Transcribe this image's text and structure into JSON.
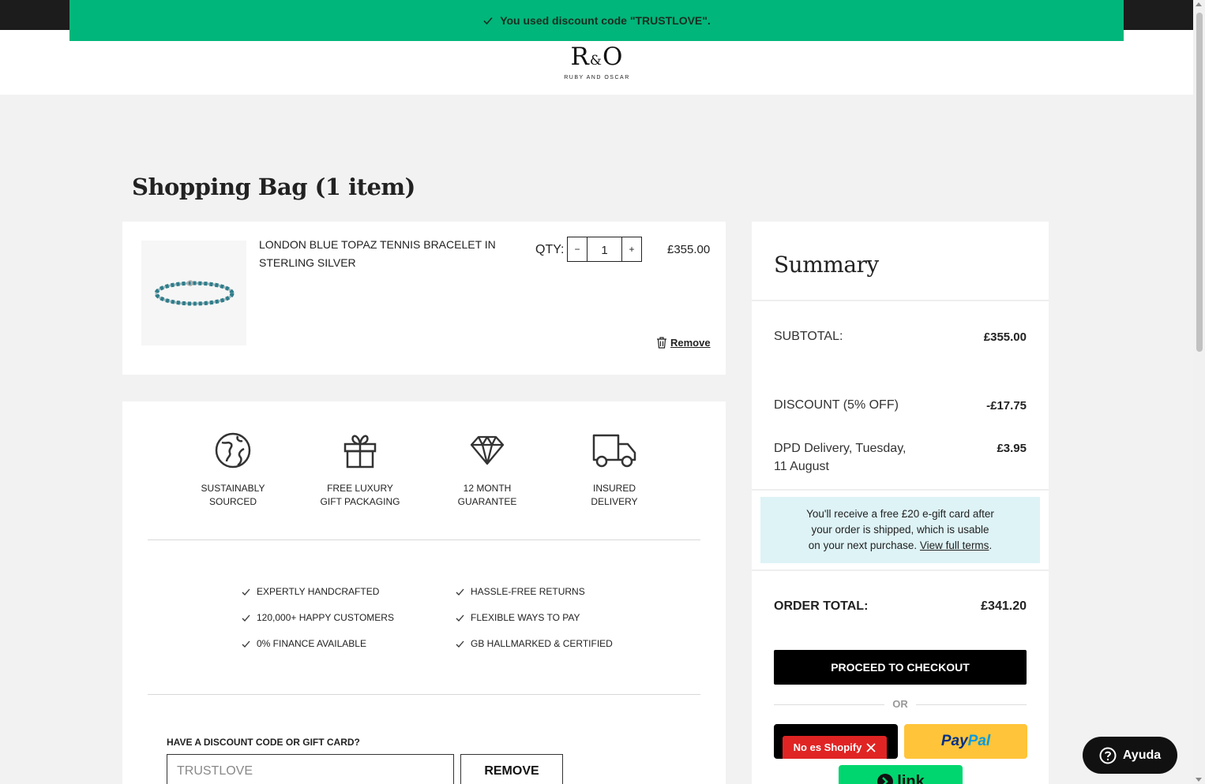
{
  "notice": {
    "text": "You used discount code \"TRUSTLOVE\"."
  },
  "logo": {
    "main_left": "R",
    "amp": "&",
    "main_right": "O",
    "sub": "RUBY AND OSCAR"
  },
  "bag": {
    "title": "Shopping Bag (1 item)",
    "item": {
      "name": "LONDON BLUE TOPAZ TENNIS BRACELET IN STERLING SILVER",
      "qty_label": "QTY:",
      "qty_minus": "−",
      "qty_value": "1",
      "qty_plus": "+",
      "price": "£355.00",
      "remove_label": "Remove"
    }
  },
  "benefits": [
    {
      "label": "SUSTAINABLY\nSOURCED",
      "icon": "globe-icon"
    },
    {
      "label": "FREE LUXURY\nGIFT PACKAGING",
      "icon": "gift-icon"
    },
    {
      "label": "12 MONTH\nGUARANTEE",
      "icon": "diamond-icon"
    },
    {
      "label": "INSURED\nDELIVERY",
      "icon": "truck-icon"
    }
  ],
  "checks": {
    "left": [
      "EXPERTLY HANDCRAFTED",
      "120,000+ HAPPY CUSTOMERS",
      "0% FINANCE AVAILABLE"
    ],
    "right": [
      "HASSLE-FREE RETURNS",
      "FLEXIBLE WAYS TO PAY",
      "GB HALLMARKED & CERTIFIED"
    ]
  },
  "discount": {
    "label": "HAVE A DISCOUNT CODE OR GIFT CARD?",
    "value": "TRUSTLOVE",
    "button": "REMOVE"
  },
  "summary": {
    "title": "Summary",
    "subtotal_label": "SUBTOTAL:",
    "subtotal_value": "£355.00",
    "discount_label": "DISCOUNT (5% OFF)",
    "discount_value": "-£17.75",
    "delivery_label_1": "DPD Delivery, Tuesday,",
    "delivery_label_2": "11 August",
    "delivery_value": "£3.95",
    "gift_line_1": "You'll receive a free £20 e-gift card after",
    "gift_line_2": "your order is shipped, which is usable",
    "gift_line_3": "on your next purchase.",
    "gift_link": "View full terms",
    "gift_end": ".",
    "total_label": "ORDER TOTAL:",
    "total_value": "£341.20",
    "checkout_label": "PROCEED TO CHECKOUT",
    "or_label": "OR",
    "not_shopify_label": "No es Shopify",
    "paypal_1": "Pay",
    "paypal_2": "Pal",
    "link_label": "link"
  },
  "help": {
    "label": "Ayuda"
  },
  "colors": {
    "notice_green": "#00b67a",
    "gift_bg": "#def3f6",
    "paypal_yellow": "#ffc439",
    "link_green": "#00d66f",
    "warning_red": "#e02424"
  }
}
